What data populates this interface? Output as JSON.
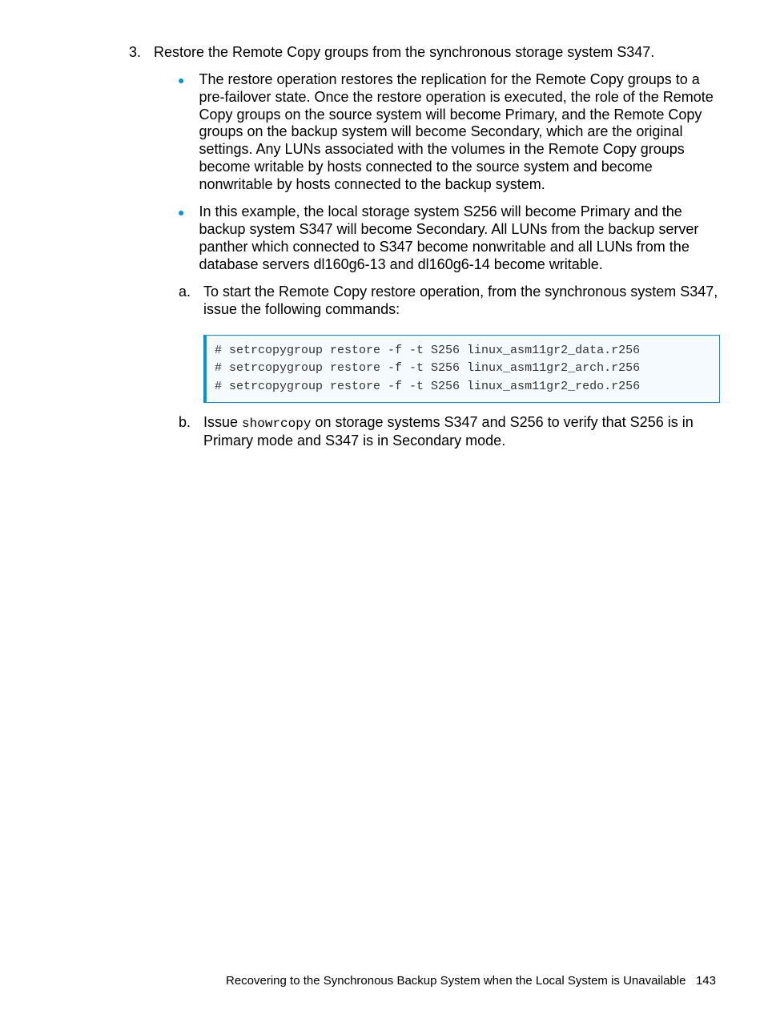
{
  "step": {
    "number": "3.",
    "title": "Restore the Remote Copy groups from the synchronous storage system S347.",
    "bullets": [
      "The restore operation restores the replication for the Remote Copy groups to a pre-failover state. Once the restore operation is executed, the role of the Remote Copy groups on the source system will become Primary, and the Remote Copy groups on the backup system will become Secondary, which are the original settings. Any LUNs associated with the volumes in the Remote Copy groups become writable by hosts connected to the source system and become nonwritable by hosts connected to the backup system.",
      "In this example, the local storage system S256 will become Primary and the backup system S347 will become Secondary. All LUNs from the backup server panther which connected to S347 become nonwritable and all LUNs from the database servers dl160g6-13 and dl160g6-14 become writable."
    ],
    "subA": {
      "label": "a.",
      "text": "To start the Remote Copy restore operation, from the synchronous system S347, issue the following commands:"
    },
    "code": "# setrcopygroup restore -f -t S256 linux_asm11gr2_data.r256\n# setrcopygroup restore -f -t S256 linux_asm11gr2_arch.r256\n# setrcopygroup restore -f -t S256 linux_asm11gr2_redo.r256",
    "subB": {
      "label": "b.",
      "prefix": "Issue ",
      "cmd": "showrcopy",
      "suffix": " on storage systems S347 and S256 to verify that S256 is in Primary mode and S347 is in Secondary mode."
    }
  },
  "footer": {
    "title": "Recovering to the Synchronous Backup System when the Local System is Unavailable",
    "page": "143"
  }
}
